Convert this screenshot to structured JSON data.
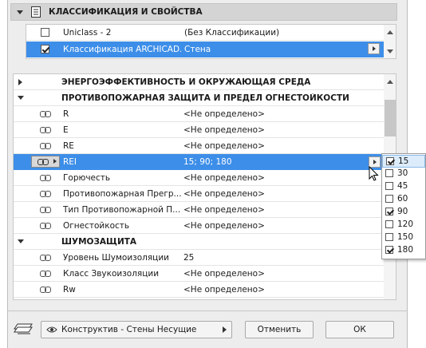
{
  "classification_section": {
    "title": "КЛАССИФИКАЦИЯ И СВОЙСТВА",
    "rows": [
      {
        "name": "Uniclass - 2",
        "value": "(Без Классификации)",
        "checked": false
      },
      {
        "name": "Классификация ARCHICAD...",
        "value": "Стена",
        "checked": true
      }
    ]
  },
  "properties": {
    "groups": [
      {
        "title": "ЭНЕРГОЭФФЕКТИВНОСТЬ И ОКРУЖАЮЩАЯ СРЕДА",
        "expanded": false
      },
      {
        "title": "ПРОТИВОПОЖАРНАЯ ЗАЩИТА И ПРЕДЕЛ ОГНЕСТОЙКОСТИ",
        "expanded": true
      },
      {
        "title": "ШУМОЗАЩИТА",
        "expanded": true
      }
    ],
    "fire_rows": [
      {
        "name": "R",
        "value": "<Не определено>"
      },
      {
        "name": "E",
        "value": "<Не определено>"
      },
      {
        "name": "RE",
        "value": "<Не определено>"
      },
      {
        "name": "REI",
        "value": "15; 90; 180"
      },
      {
        "name": "Горючесть",
        "value": "<Не определено>"
      },
      {
        "name": "Противопожарная Прегр...",
        "value": "<Не определено>"
      },
      {
        "name": "Тип Противопожарной П...",
        "value": "<Не определено>"
      },
      {
        "name": "Огнестойкость",
        "value": "<Не определено>"
      }
    ],
    "noise_rows": [
      {
        "name": "Уровень Шумоизоляции",
        "value": "25"
      },
      {
        "name": "Класс Звукоизоляции",
        "value": "<Не определено>"
      },
      {
        "name": "Rw",
        "value": "<Не определено>"
      }
    ]
  },
  "rei_dropdown": {
    "options": [
      {
        "label": "15",
        "checked": true
      },
      {
        "label": "30",
        "checked": false
      },
      {
        "label": "45",
        "checked": false
      },
      {
        "label": "60",
        "checked": false
      },
      {
        "label": "90",
        "checked": true
      },
      {
        "label": "120",
        "checked": false
      },
      {
        "label": "150",
        "checked": false
      },
      {
        "label": "180",
        "checked": true
      }
    ]
  },
  "footer": {
    "layer_combo": "Конструктив - Стены Несущие",
    "cancel_label": "Отменить",
    "ok_label": "ОК"
  },
  "icons": [
    "checklist-icon",
    "eye-icon",
    "layers-icon",
    "link-icon",
    "cursor-icon"
  ],
  "colors": {
    "selection": "#3d8ee8",
    "panel_bg": "#ededed",
    "header_bg": "#d4d4d4"
  }
}
